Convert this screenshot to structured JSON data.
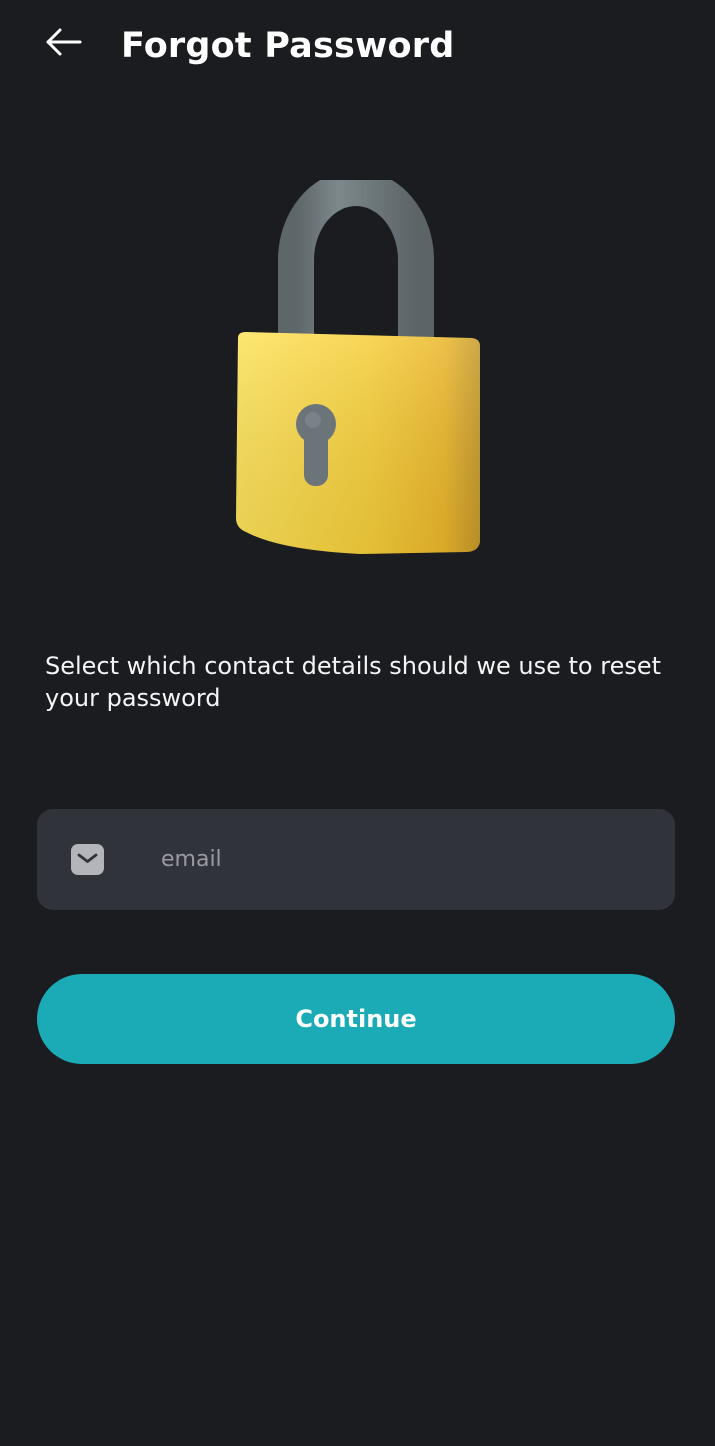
{
  "header": {
    "title": "Forgot Password",
    "back_icon": "arrow-left-icon"
  },
  "illustration": {
    "icon": "padlock-icon",
    "colors": {
      "body": "#f5c932",
      "shackle": "#6b7579",
      "keyhole": "#6b7579"
    }
  },
  "description": "Select which contact details should we use to reset your password",
  "email_field": {
    "icon": "mail-icon",
    "placeholder": "email",
    "value": ""
  },
  "continue_button": {
    "label": "Continue"
  },
  "theme": {
    "background": "#1b1c20",
    "field_background": "#31333b",
    "accent": "#1babb6",
    "placeholder": "#9a9ba2"
  }
}
